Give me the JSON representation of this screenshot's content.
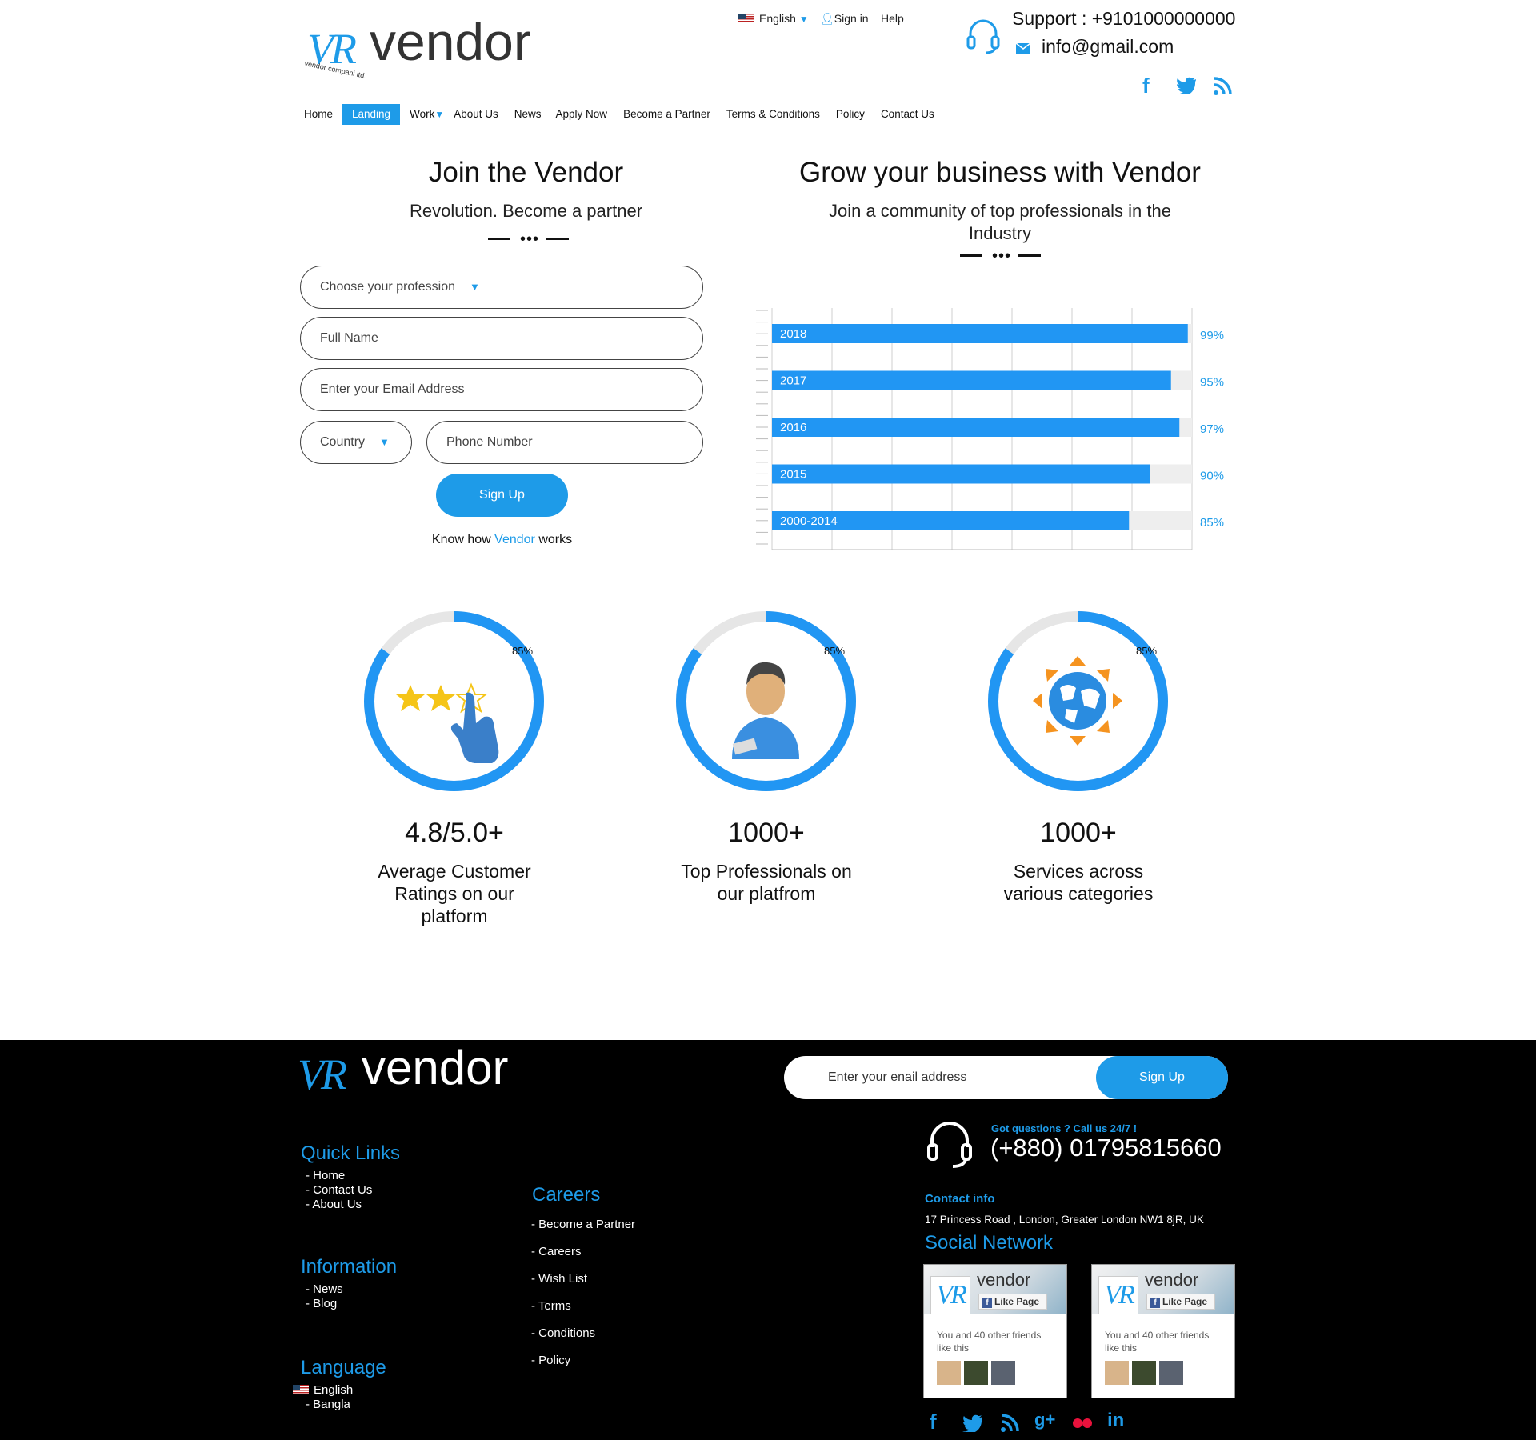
{
  "brand": {
    "logo_mark": "VR",
    "name": "vendor",
    "tagline": "vendor compani ltd."
  },
  "topbar": {
    "language": "English",
    "sign_in": "Sign in",
    "help": "Help",
    "support": "Support : +9101000000000",
    "email": "info@gmail.com"
  },
  "nav": {
    "items": [
      "Home",
      "Landing",
      "Work",
      "About Us",
      "News",
      "Apply Now",
      "Become a Partner",
      "Terms & Conditions",
      "Policy",
      "Contact Us"
    ],
    "active": "Landing"
  },
  "join": {
    "title": "Join the Vendor",
    "subtitle": "Revolution. Become a partner",
    "form": {
      "profession_placeholder": "Choose your profession",
      "name_placeholder": "Full Name",
      "email_placeholder": "Enter your Email Address",
      "country_placeholder": "Country",
      "phone_placeholder": "Phone Number",
      "submit": "Sign Up"
    },
    "know_pre": "Know how ",
    "know_link": "Vendor",
    "know_post": " works"
  },
  "grow": {
    "title": "Grow your business with Vendor",
    "subtitle_line1": "Join a community of top professionals in the",
    "subtitle_line2": "Industry"
  },
  "chart_data": {
    "type": "bar",
    "orientation": "horizontal",
    "categories": [
      "2018",
      "2017",
      "2016",
      "2015",
      "2000-2014"
    ],
    "values": [
      99,
      95,
      97,
      90,
      85
    ],
    "value_labels": [
      "99%",
      "95%",
      "97%",
      "90%",
      "85%"
    ],
    "xlim": [
      0,
      100
    ],
    "grid": true,
    "bar_color": "#2196f3",
    "track_color": "#eeeeee",
    "label_color": "#1e9be8"
  },
  "stats": [
    {
      "icon": "rating-stars-icon",
      "percent": "85%",
      "percent_value": 85,
      "number": "4.8/5.0+",
      "label_lines": [
        "Average Customer",
        "Ratings on our",
        "platform"
      ]
    },
    {
      "icon": "professional-person-icon",
      "percent": "85%",
      "percent_value": 85,
      "number": "1000+",
      "label_lines": [
        "Top Professionals on",
        "our platfrom"
      ]
    },
    {
      "icon": "globe-arrows-icon",
      "percent": "85%",
      "percent_value": 85,
      "number": "1000+",
      "label_lines": [
        "Services across",
        "various categories"
      ]
    }
  ],
  "footer": {
    "logo_mark": "VR",
    "name": "vendor",
    "newsletter": {
      "placeholder": "Enter your enail address",
      "button": "Sign Up"
    },
    "call_label": "Got questions ? Call us 24/7 !",
    "phone": "(+880) 01795815660",
    "contact_title": "Contact info",
    "address": "17 Princess Road , London, Greater London  NW1 8jR, UK",
    "social_title": "Social Network",
    "quick_links": {
      "title": "Quick Links",
      "items": [
        "- Home",
        "- Contact Us",
        "- About Us"
      ]
    },
    "information": {
      "title": "Information",
      "items": [
        "- News",
        "- Blog"
      ]
    },
    "language": {
      "title": "Language",
      "items": [
        "English",
        "- Bangla"
      ]
    },
    "careers": {
      "title": "Careers",
      "items": [
        "- Become a Partner",
        "- Careers",
        "- Wish List",
        "- Terms",
        "- Conditions",
        "- Policy"
      ]
    },
    "fb_widget": {
      "name": "vendor",
      "like": "Like Page",
      "text": "You and 40 other friends like this"
    },
    "social_icons": [
      "facebook-icon",
      "twitter-icon",
      "rss-icon",
      "google-plus-icon",
      "flickr-icon",
      "linkedin-icon"
    ],
    "social_colors": [
      "#1e9be8",
      "#1e9be8",
      "#1e9be8",
      "#1e9be8",
      "#e8123c",
      "#1e9be8"
    ]
  }
}
